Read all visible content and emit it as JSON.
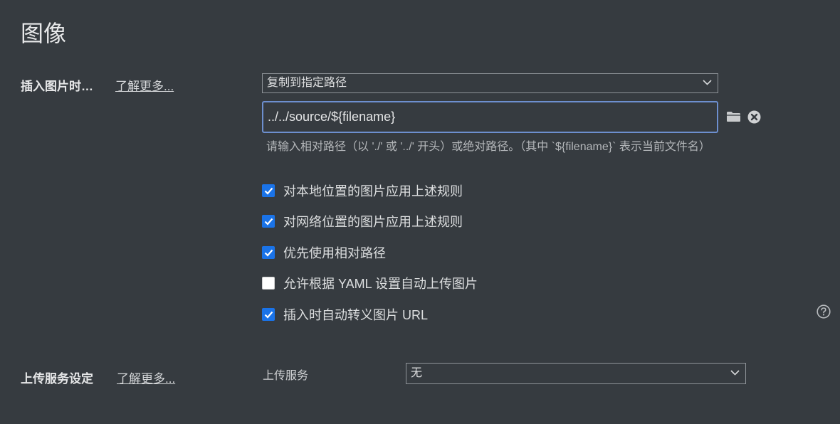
{
  "page_title": "图像",
  "insert_section": {
    "label": "插入图片时…",
    "learn_more": "了解更多...",
    "action_select": {
      "value": "复制到指定路径"
    },
    "path_input": {
      "value": "../../source/${filename}"
    },
    "hint": "请输入相对路径（以 './' 或 '../' 开头）或绝对路径。（其中 `${filename}` 表示当前文件名）",
    "options": [
      {
        "label": "对本地位置的图片应用上述规则",
        "checked": true
      },
      {
        "label": "对网络位置的图片应用上述规则",
        "checked": true
      },
      {
        "label": "优先使用相对路径",
        "checked": true
      },
      {
        "label": "允许根据 YAML 设置自动上传图片",
        "checked": false
      },
      {
        "label": "插入时自动转义图片 URL",
        "checked": true
      }
    ]
  },
  "upload_section": {
    "label": "上传服务设定",
    "learn_more": "了解更多...",
    "service_label": "上传服务",
    "service_select": {
      "value": "无"
    }
  },
  "icons": {
    "folder": "folder-icon",
    "clear": "clear-circle-icon",
    "help": "help-circle-icon",
    "chevron": "chevron-down-icon"
  },
  "colors": {
    "background": "#363b40",
    "checkbox_accent": "#1a73e8",
    "input_focus_border": "#6d8fcf"
  }
}
